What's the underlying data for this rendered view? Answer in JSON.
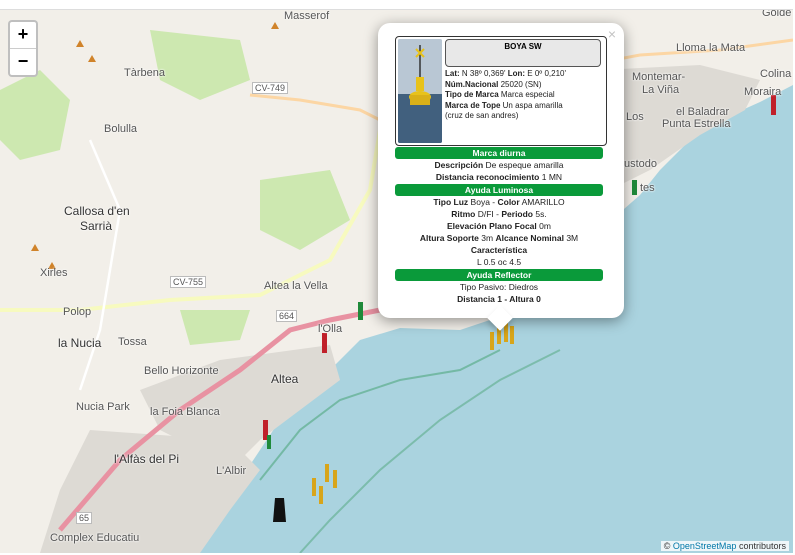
{
  "zoom": {
    "in_label": "+",
    "out_label": "−"
  },
  "places": [
    {
      "id": "masserof",
      "text": "Masserof"
    },
    {
      "id": "tarbena",
      "text": "Tàrbena"
    },
    {
      "id": "bolulla",
      "text": "Bolulla"
    },
    {
      "id": "callosa1",
      "text": "Callosa d'en"
    },
    {
      "id": "callosa2",
      "text": "Sarrià"
    },
    {
      "id": "xirles",
      "text": "Xirles"
    },
    {
      "id": "polop",
      "text": "Polop"
    },
    {
      "id": "lanucia",
      "text": "la Nucia"
    },
    {
      "id": "tossa",
      "text": "Tossa"
    },
    {
      "id": "bellohor",
      "text": "Bello Horizonte"
    },
    {
      "id": "altea",
      "text": "Altea"
    },
    {
      "id": "alteavella",
      "text": "Altea la Vella"
    },
    {
      "id": "lolla",
      "text": "l'Olla"
    },
    {
      "id": "nucia_park",
      "text": "Nucia Park"
    },
    {
      "id": "foiablanca",
      "text": "la Foia Blanca"
    },
    {
      "id": "alfas",
      "text": "l'Alfàs del Pi"
    },
    {
      "id": "albir",
      "text": "L'Albir"
    },
    {
      "id": "complex",
      "text": "Complex Educatiu"
    },
    {
      "id": "llomamata",
      "text": "Lloma la Mata"
    },
    {
      "id": "montemar",
      "text": "Montemar-"
    },
    {
      "id": "lavina",
      "text": "La Viña"
    },
    {
      "id": "baladrar",
      "text": "el Baladrar"
    },
    {
      "id": "puntaestrella",
      "text": "Punta Estrella"
    },
    {
      "id": "colina",
      "text": "Colina"
    },
    {
      "id": "morai",
      "text": "Moraira"
    },
    {
      "id": "golde",
      "text": "Golde"
    },
    {
      "id": "los",
      "text": "Los"
    },
    {
      "id": "ustodo",
      "text": "ustodo"
    },
    {
      "id": "tes",
      "text": "tes"
    }
  ],
  "roads": [
    {
      "id": "cv749",
      "text": "CV-749"
    },
    {
      "id": "cv755",
      "text": "CV-755"
    },
    {
      "id": "n664",
      "text": "664"
    },
    {
      "id": "n65",
      "text": "65"
    }
  ],
  "popup": {
    "close": "×",
    "title": "BOYA SW",
    "lat_label": "Lat:",
    "lat_value": "N 38º 0,369'",
    "lon_label": "Lon:",
    "lon_value": "E 0º 0,210'",
    "num_label": "Núm.Nacional",
    "num_value": "25020 (SN)",
    "tipo_label": "Tipo de Marca",
    "tipo_value": "Marca especial",
    "tope_label": "Marca de Tope",
    "tope_value": "Un aspa amarilla",
    "tope_value2": "(cruz de san andres)",
    "section1": "Marca diurna",
    "desc_label": "Descripción",
    "desc_value": "De espeque amarilla",
    "dist_label": "Distancia reconocimiento",
    "dist_value": "1 MN",
    "section2": "Ayuda Luminosa",
    "luz_label": "Tipo Luz",
    "luz_value": "Boya",
    "color_label": "Color",
    "color_value": "AMARILLO",
    "ritmo_label": "Ritmo",
    "ritmo_value": "D/FI",
    "periodo_label": "Periodo",
    "periodo_value": "5s.",
    "elev_label": "Elevación Plano Focal",
    "elev_value": "0m",
    "altura_label": "Altura Soporte",
    "altura_value": "3m",
    "alcance_label": "Alcance Nominal",
    "alcance_value": "3M",
    "caract_label": "Característica",
    "caract_value": "L 0.5 oc 4.5",
    "section3": "Ayuda Reflector",
    "pasivo_label": "Tipo Pasivo:",
    "pasivo_value": "Diedros",
    "distalt_label": "Distancia 1 - Altura 0"
  },
  "attribution": {
    "prefix": "©",
    "link": "OpenStreetMap",
    "suffix": "contributors"
  },
  "colors": {
    "sea": "#aad3df",
    "land": "#f2efe9",
    "urban": "#dddad4",
    "park": "#cde8b0",
    "road": "#e892a2",
    "green_band": "#0a9a3a"
  }
}
